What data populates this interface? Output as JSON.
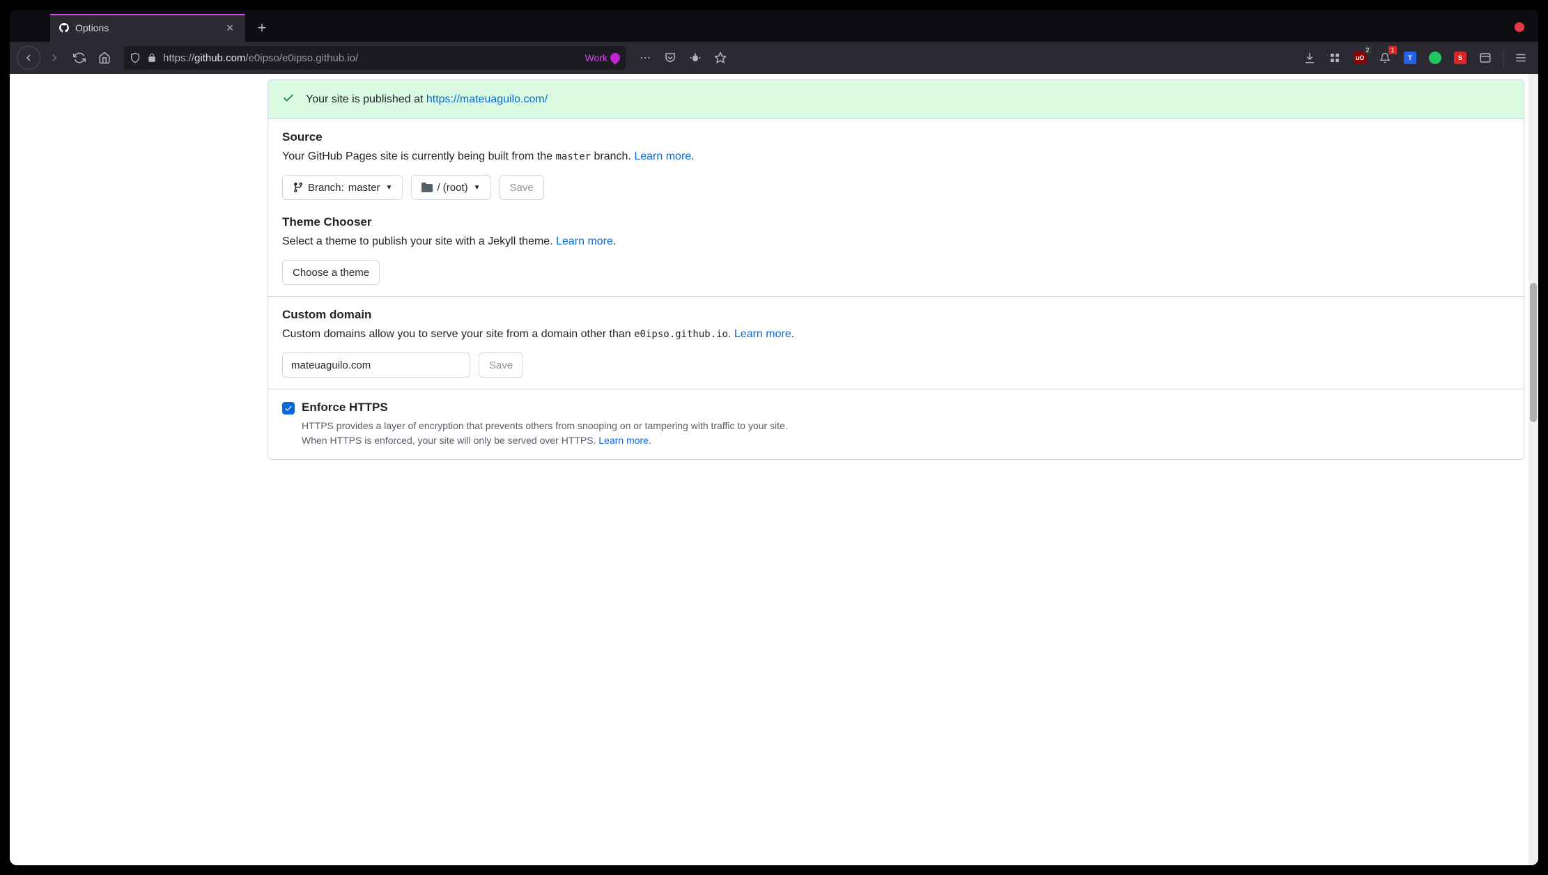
{
  "browser": {
    "tab": {
      "title": "Options"
    },
    "url_prefix": "https://",
    "url_host": "github.com",
    "url_path": "/e0ipso/e0ipso.github.io/",
    "container": "Work",
    "ext_badges": {
      "ubo": "2",
      "bell": "1"
    }
  },
  "flash": {
    "prefix": "Your site is published at ",
    "link": "https://mateuaguilo.com/"
  },
  "source": {
    "heading": "Source",
    "desc_pre": "Your GitHub Pages site is currently being built from the ",
    "desc_code": "master",
    "desc_post": " branch. ",
    "learn_more": "Learn more",
    "branch_label": "Branch: ",
    "branch_value": "master",
    "folder_value": "/ (root)",
    "save": "Save"
  },
  "theme": {
    "heading": "Theme Chooser",
    "desc": "Select a theme to publish your site with a Jekyll theme. ",
    "learn_more": "Learn more",
    "button": "Choose a theme"
  },
  "domain": {
    "heading": "Custom domain",
    "desc_pre": "Custom domains allow you to serve your site from a domain other than ",
    "desc_code": "e0ipso.github.io",
    "desc_post": ". ",
    "learn_more": "Learn more",
    "input_value": "mateuaguilo.com",
    "save": "Save"
  },
  "https": {
    "label": "Enforce HTTPS",
    "help1": "HTTPS provides a layer of encryption that prevents others from snooping on or tampering with traffic to your site.",
    "help2_pre": "When HTTPS is enforced, your site will only be served over HTTPS. ",
    "learn_more": "Learn more"
  }
}
